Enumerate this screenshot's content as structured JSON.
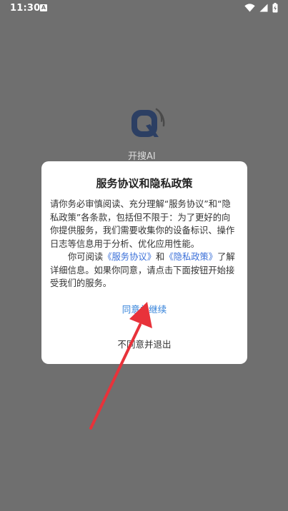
{
  "status_bar": {
    "time": "11:30",
    "badge_letter": "A",
    "icons": [
      "wifi-icon",
      "cellular-signal-icon",
      "battery-icon"
    ]
  },
  "app": {
    "name": "开搜AI",
    "logo_icon": "kaisou-logo-icon"
  },
  "dialog": {
    "title": "服务协议和隐私政策",
    "paragraph1": "请你务必审慎阅读、充分理解“服务协议”和“隐私政策”各条款，包括但不限于：为了更好的向你提供服务，我们需要收集你的设备标识、操作日志等信息用于分析、优化应用性能。",
    "paragraph2_prefix": "你可阅读",
    "service_link": "《服务协议》",
    "and_text": "和",
    "privacy_link": "《隐私政策》",
    "paragraph2_suffix": "了解详细信息。如果你同意，请点击下面按钮开始接受我们的服务。",
    "agree_label": "同意并继续",
    "disagree_label": "不同意并退出"
  },
  "colors": {
    "overlay": "#6f6f6f",
    "link": "#3a6fd8",
    "agree": "#2f7fd9",
    "annotation_arrow": "#e8323a"
  }
}
